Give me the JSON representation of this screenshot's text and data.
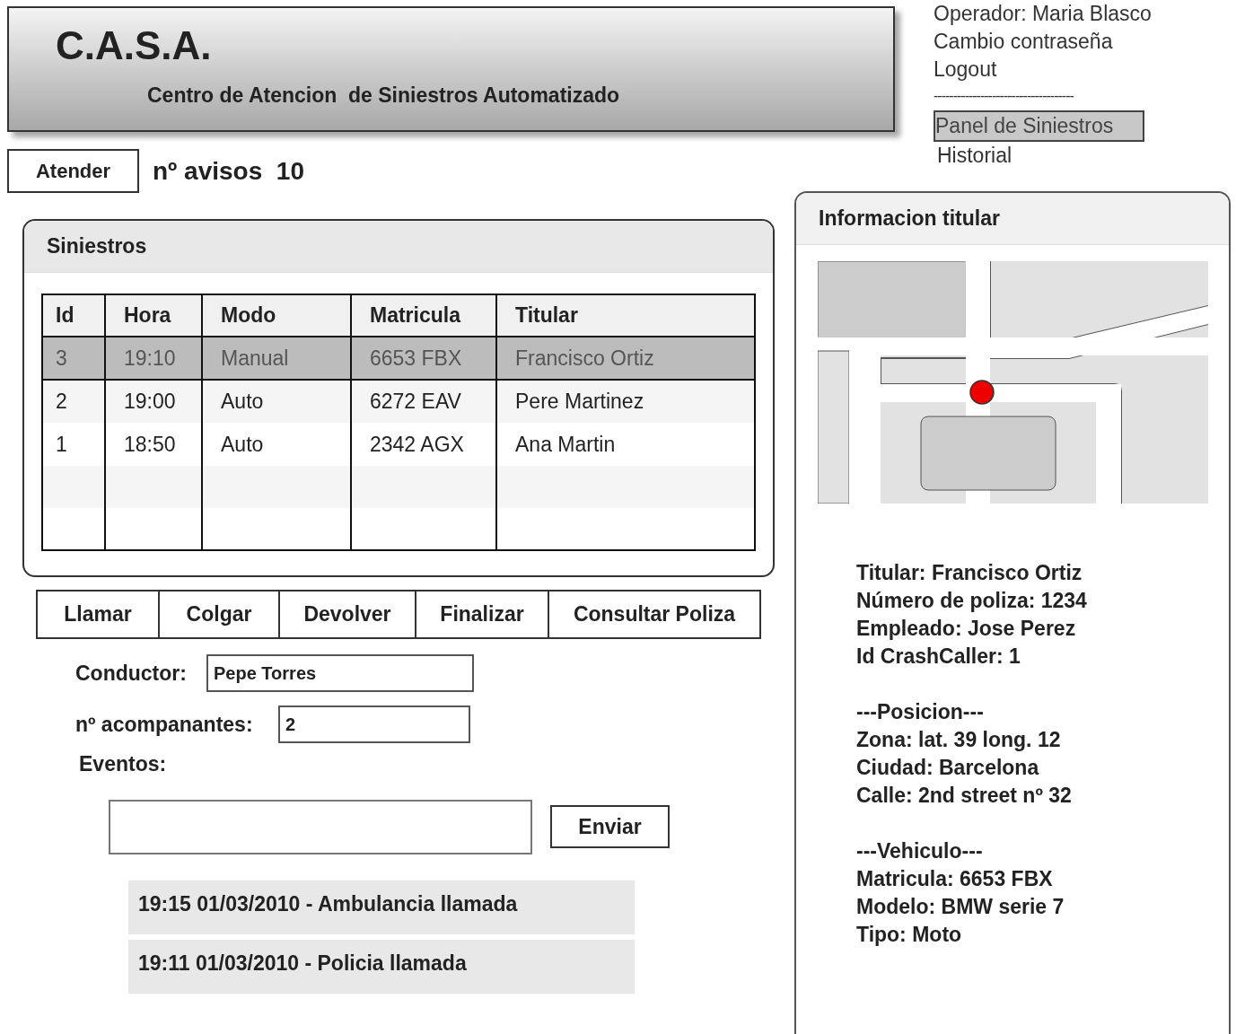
{
  "header": {
    "title": "C.A.S.A.",
    "subtitle": "Centro de Atencion  de Siniestros Automatizado"
  },
  "user_menu": {
    "operator": "Operador: Maria Blasco",
    "links": [
      "Cambio contraseña",
      "Logout"
    ],
    "separator": "------------------------------------",
    "nav": [
      {
        "label": "Panel de Siniestros",
        "selected": true
      },
      {
        "label": "Historial",
        "selected": false
      }
    ]
  },
  "toolbar": {
    "button": "Atender",
    "count_label": "nº avisos  10"
  },
  "siniestros": {
    "title": "Siniestros",
    "columns": [
      "Id",
      "Hora",
      "Modo",
      "Matricula",
      "Titular"
    ],
    "rows": [
      {
        "cells": [
          "3",
          "19:10",
          "Manual",
          "6653 FBX",
          "Francisco Ortiz"
        ],
        "selected": true
      },
      {
        "cells": [
          "2",
          "19:00",
          "Auto",
          "6272 EAV",
          "Pere Martinez"
        ],
        "selected": false
      },
      {
        "cells": [
          "1",
          "18:50",
          "Auto",
          "2342 AGX",
          "Ana Martin"
        ],
        "selected": false
      }
    ]
  },
  "actions": [
    "Llamar",
    "Colgar",
    "Devolver",
    "Finalizar",
    "Consultar Poliza"
  ],
  "form": {
    "conductor_label": "Conductor:",
    "conductor_value": "Pepe Torres",
    "companions_label": "nº acompanantes:",
    "companions_value": "2",
    "events_label": "Eventos:",
    "send_button": "Enviar"
  },
  "events": [
    "19:15 01/03/2010 - Ambulancia llamada",
    "19:11 01/03/2010 - Policia llamada"
  ],
  "info_panel": {
    "title": "Informacion titular",
    "sections": [
      {
        "lines": [
          "Titular: Francisco Ortiz",
          "Número de poliza: 1234",
          "Empleado: Jose Perez",
          "Id CrashCaller: 1"
        ]
      },
      {
        "lines": [
          "---Posicion---",
          "Zona: lat. 39 long. 12",
          "Ciudad: Barcelona",
          "Calle: 2nd street nº 32"
        ]
      },
      {
        "lines": [
          "---Vehiculo---",
          "Matricula: 6653 FBX",
          "Modelo: BMW serie 7",
          "Tipo: Moto"
        ]
      }
    ]
  }
}
